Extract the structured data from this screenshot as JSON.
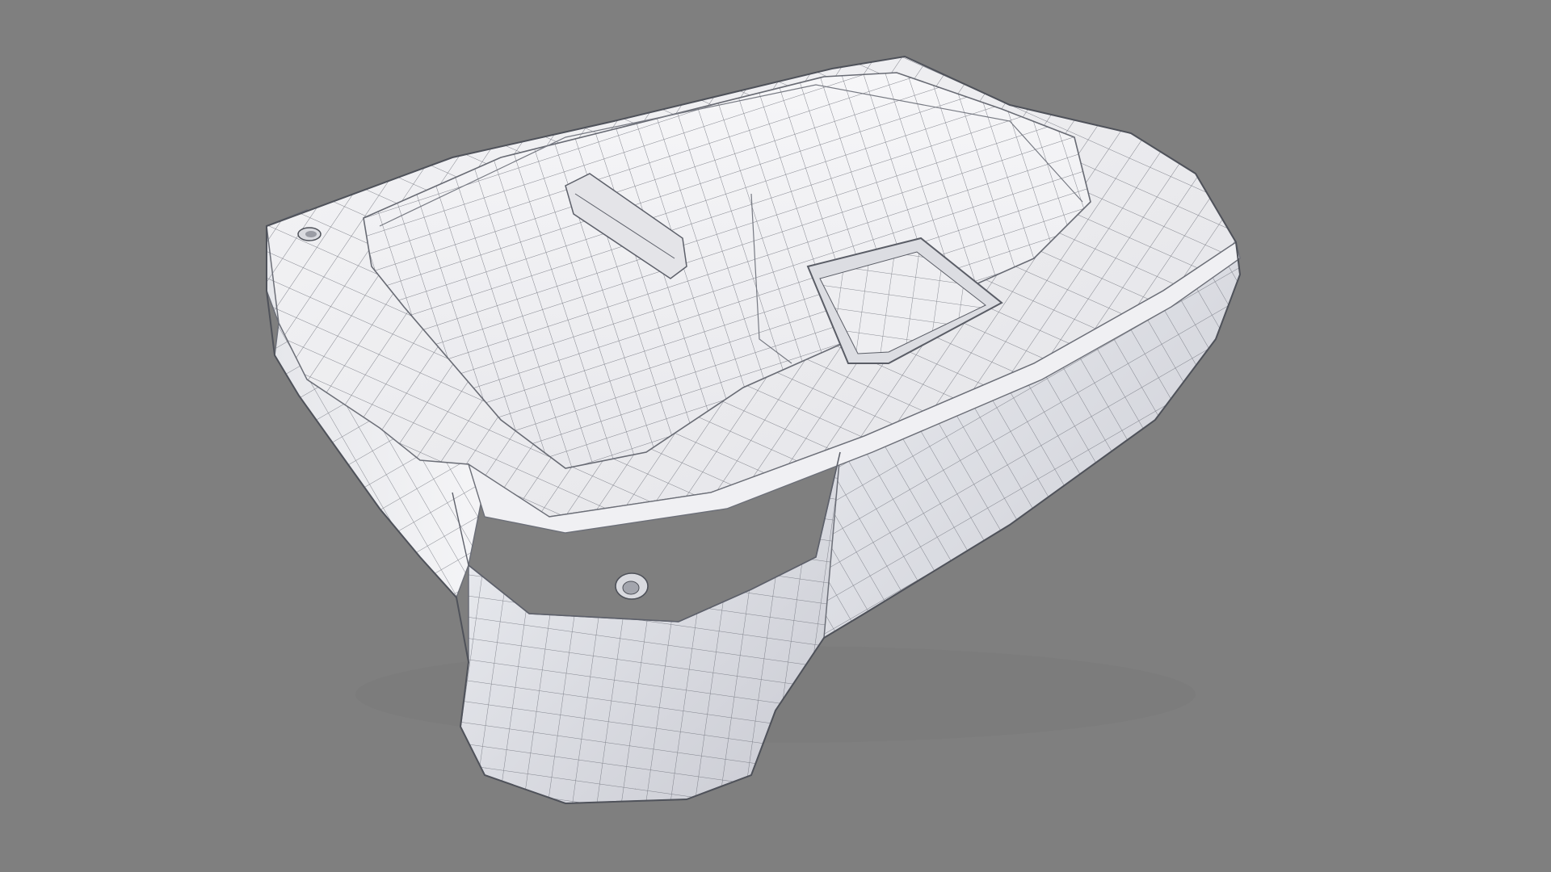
{
  "viewport": {
    "background_color": "#7f7f7f",
    "view_mode": "wireframe-on-shaded"
  },
  "model": {
    "kind": "hard-surface 3D mesh (subdivision topology)",
    "surface_color": "#efeff1",
    "shadow_color": "#cfd0d6",
    "wire_color": "#5a5d66",
    "features": [
      "raised-top-plate",
      "slot-recess",
      "square-pocket",
      "screw-hole-left",
      "screw-hole-front",
      "front-bumper"
    ]
  }
}
